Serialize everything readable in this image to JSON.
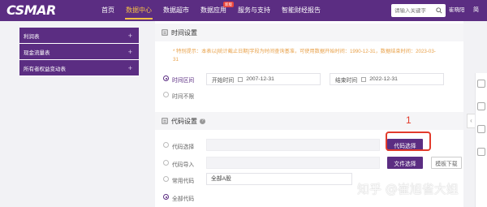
{
  "app": {
    "logo": "CSMAR"
  },
  "nav": {
    "items": [
      {
        "label": "首页"
      },
      {
        "label": "数据中心"
      },
      {
        "label": "数据超市"
      },
      {
        "label": "数据应用"
      },
      {
        "label": "服务与支持"
      },
      {
        "label": "智能财经报告"
      }
    ],
    "new_badge": "新版",
    "search_placeholder": "请输入关键字",
    "user": "崔晓阳",
    "lang": "简"
  },
  "sidebar": {
    "items": [
      {
        "label": "利润表"
      },
      {
        "label": "现金流量表"
      },
      {
        "label": "所有者权益变动表"
      }
    ],
    "expand_symbol": "+"
  },
  "time_section": {
    "title": "时间设置",
    "tip_line1": "* 特别提示：本表以[统计截止日期]字段为时间查询基准，可使用数据开始时间：1990-12-31，数据结束时间：2023-03-",
    "tip_line2": "31",
    "range_label": "时间区间",
    "start_caption": "开始时间",
    "start_value": "2007-12-31",
    "end_caption": "结束时间",
    "end_value": "2022-12-31",
    "unlimited_label": "时间不限"
  },
  "code_section": {
    "title": "代码设置",
    "select_label": "代码选择",
    "select_button": "代码选择",
    "import_label": "代码导入",
    "file_button": "文件选择",
    "template_button": "模板下载",
    "common_label": "常用代码",
    "common_value": "全部A股",
    "all_label": "全部代码"
  },
  "annotation": {
    "number": "1"
  },
  "watermark": "知乎 @崔旭雀大姐",
  "colors": {
    "brand": "#5b2d82",
    "accent": "#f7c046",
    "annotation": "#e23b2c",
    "tip": "#e8a14a"
  }
}
